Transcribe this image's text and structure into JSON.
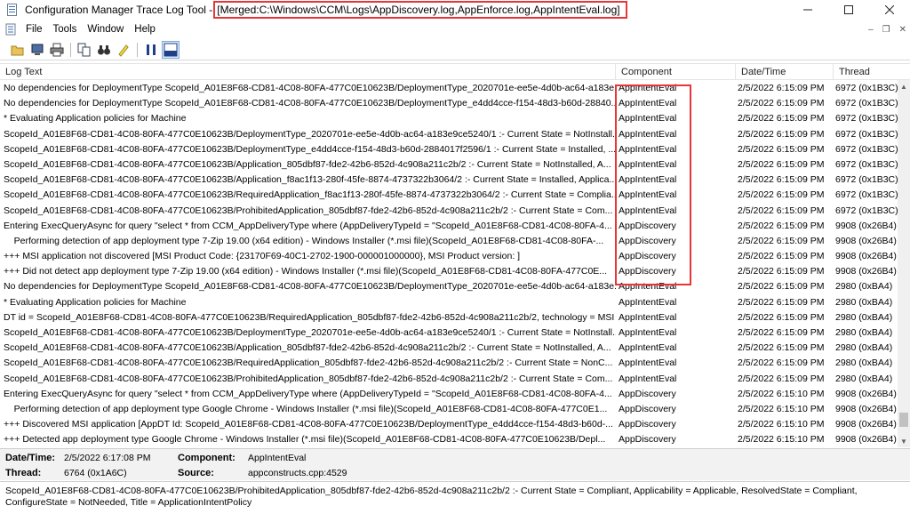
{
  "window": {
    "app_title": "Configuration Manager Trace Log Tool -",
    "merged_title": "[Merged:C:\\Windows\\CCM\\Logs\\AppDiscovery.log,AppEnforce.log,AppIntentEval.log]"
  },
  "menu": [
    "File",
    "Tools",
    "Window",
    "Help"
  ],
  "columns": {
    "log_text": "Log Text",
    "component": "Component",
    "datetime": "Date/Time",
    "thread": "Thread"
  },
  "rows": [
    {
      "text": "No dependencies for DeploymentType ScopeId_A01E8F68-CD81-4C08-80FA-477C0E10623B/DeploymentType_2020701e-ee5e-4d0b-ac64-a183e...",
      "component": "AppIntentEval",
      "datetime": "2/5/2022 6:15:09 PM",
      "thread": "6972 (0x1B3C)"
    },
    {
      "text": "No dependencies for DeploymentType ScopeId_A01E8F68-CD81-4C08-80FA-477C0E10623B/DeploymentType_e4dd4cce-f154-48d3-b60d-28840...",
      "component": "AppIntentEval",
      "datetime": "2/5/2022 6:15:09 PM",
      "thread": "6972 (0x1B3C)"
    },
    {
      "text": "* Evaluating Application policies for Machine",
      "component": "AppIntentEval",
      "datetime": "2/5/2022 6:15:09 PM",
      "thread": "6972 (0x1B3C)"
    },
    {
      "text": "ScopeId_A01E8F68-CD81-4C08-80FA-477C0E10623B/DeploymentType_2020701e-ee5e-4d0b-ac64-a183e9ce5240/1 :- Current State = NotInstall...",
      "component": "AppIntentEval",
      "datetime": "2/5/2022 6:15:09 PM",
      "thread": "6972 (0x1B3C)"
    },
    {
      "text": "ScopeId_A01E8F68-CD81-4C08-80FA-477C0E10623B/DeploymentType_e4dd4cce-f154-48d3-b60d-2884017f2596/1 :- Current State = Installed, ...",
      "component": "AppIntentEval",
      "datetime": "2/5/2022 6:15:09 PM",
      "thread": "6972 (0x1B3C)"
    },
    {
      "text": "ScopeId_A01E8F68-CD81-4C08-80FA-477C0E10623B/Application_805dbf87-fde2-42b6-852d-4c908a211c2b/2 :- Current State = NotInstalled, A...",
      "component": "AppIntentEval",
      "datetime": "2/5/2022 6:15:09 PM",
      "thread": "6972 (0x1B3C)"
    },
    {
      "text": "ScopeId_A01E8F68-CD81-4C08-80FA-477C0E10623B/Application_f8ac1f13-280f-45fe-8874-4737322b3064/2 :- Current State = Installed, Applica...",
      "component": "AppIntentEval",
      "datetime": "2/5/2022 6:15:09 PM",
      "thread": "6972 (0x1B3C)"
    },
    {
      "text": "ScopeId_A01E8F68-CD81-4C08-80FA-477C0E10623B/RequiredApplication_f8ac1f13-280f-45fe-8874-4737322b3064/2 :- Current State = Complia...",
      "component": "AppIntentEval",
      "datetime": "2/5/2022 6:15:09 PM",
      "thread": "6972 (0x1B3C)"
    },
    {
      "text": "ScopeId_A01E8F68-CD81-4C08-80FA-477C0E10623B/ProhibitedApplication_805dbf87-fde2-42b6-852d-4c908a211c2b/2 :- Current State = Com...",
      "component": "AppIntentEval",
      "datetime": "2/5/2022 6:15:09 PM",
      "thread": "6972 (0x1B3C)"
    },
    {
      "text": "Entering ExecQueryAsync for query \"select * from CCM_AppDeliveryType where (AppDeliveryTypeId = \"ScopeId_A01E8F68-CD81-4C08-80FA-4...",
      "component": "AppDiscovery",
      "datetime": "2/5/2022 6:15:09 PM",
      "thread": "9908 (0x26B4)"
    },
    {
      "text": "    Performing detection of app deployment type 7-Zip 19.00 (x64 edition) - Windows Installer (*.msi file)(ScopeId_A01E8F68-CD81-4C08-80FA-...",
      "component": "AppDiscovery",
      "datetime": "2/5/2022 6:15:09 PM",
      "thread": "9908 (0x26B4)"
    },
    {
      "text": "+++ MSI application not discovered [MSI Product Code: {23170F69-40C1-2702-1900-000001000000}, MSI Product version: ]",
      "component": "AppDiscovery",
      "datetime": "2/5/2022 6:15:09 PM",
      "thread": "9908 (0x26B4)"
    },
    {
      "text": "+++ Did not detect app deployment type 7-Zip 19.00 (x64 edition) - Windows Installer (*.msi file)(ScopeId_A01E8F68-CD81-4C08-80FA-477C0E...",
      "component": "AppDiscovery",
      "datetime": "2/5/2022 6:15:09 PM",
      "thread": "9908 (0x26B4)"
    },
    {
      "text": "No dependencies for DeploymentType ScopeId_A01E8F68-CD81-4C08-80FA-477C0E10623B/DeploymentType_2020701e-ee5e-4d0b-ac64-a183e...",
      "component": "AppIntentEval",
      "datetime": "2/5/2022 6:15:09 PM",
      "thread": "2980 (0xBA4)"
    },
    {
      "text": "* Evaluating Application policies for Machine",
      "component": "AppIntentEval",
      "datetime": "2/5/2022 6:15:09 PM",
      "thread": "2980 (0xBA4)"
    },
    {
      "text": "DT id = ScopeId_A01E8F68-CD81-4C08-80FA-477C0E10623B/RequiredApplication_805dbf87-fde2-42b6-852d-4c908a211c2b/2, technology = MSI",
      "component": "AppIntentEval",
      "datetime": "2/5/2022 6:15:09 PM",
      "thread": "2980 (0xBA4)"
    },
    {
      "text": "ScopeId_A01E8F68-CD81-4C08-80FA-477C0E10623B/DeploymentType_2020701e-ee5e-4d0b-ac64-a183e9ce5240/1 :- Current State = NotInstall...",
      "component": "AppIntentEval",
      "datetime": "2/5/2022 6:15:09 PM",
      "thread": "2980 (0xBA4)"
    },
    {
      "text": "ScopeId_A01E8F68-CD81-4C08-80FA-477C0E10623B/Application_805dbf87-fde2-42b6-852d-4c908a211c2b/2 :- Current State = NotInstalled, A...",
      "component": "AppIntentEval",
      "datetime": "2/5/2022 6:15:09 PM",
      "thread": "2980 (0xBA4)"
    },
    {
      "text": "ScopeId_A01E8F68-CD81-4C08-80FA-477C0E10623B/RequiredApplication_805dbf87-fde2-42b6-852d-4c908a211c2b/2 :- Current State = NonC...",
      "component": "AppIntentEval",
      "datetime": "2/5/2022 6:15:09 PM",
      "thread": "2980 (0xBA4)"
    },
    {
      "text": "ScopeId_A01E8F68-CD81-4C08-80FA-477C0E10623B/ProhibitedApplication_805dbf87-fde2-42b6-852d-4c908a211c2b/2 :- Current State = Com...",
      "component": "AppIntentEval",
      "datetime": "2/5/2022 6:15:09 PM",
      "thread": "2980 (0xBA4)"
    },
    {
      "text": "Entering ExecQueryAsync for query \"select * from CCM_AppDeliveryType where (AppDeliveryTypeId = \"ScopeId_A01E8F68-CD81-4C08-80FA-4...",
      "component": "AppDiscovery",
      "datetime": "2/5/2022 6:15:10 PM",
      "thread": "9908 (0x26B4)"
    },
    {
      "text": "    Performing detection of app deployment type Google Chrome - Windows Installer (*.msi file)(ScopeId_A01E8F68-CD81-4C08-80FA-477C0E1...",
      "component": "AppDiscovery",
      "datetime": "2/5/2022 6:15:10 PM",
      "thread": "9908 (0x26B4)"
    },
    {
      "text": "+++ Discovered MSI application [AppDT Id: ScopeId_A01E8F68-CD81-4C08-80FA-477C0E10623B/DeploymentType_e4dd4cce-f154-48d3-b60d-...",
      "component": "AppDiscovery",
      "datetime": "2/5/2022 6:15:10 PM",
      "thread": "9908 (0x26B4)"
    },
    {
      "text": "+++ Detected app deployment type Google Chrome - Windows Installer (*.msi file)(ScopeId_A01E8F68-CD81-4C08-80FA-477C0E10623B/Depl...",
      "component": "AppDiscovery",
      "datetime": "2/5/2022 6:15:10 PM",
      "thread": "9908 (0x26B4)"
    }
  ],
  "details": {
    "datetime_label": "Date/Time:",
    "datetime_value": "2/5/2022 6:17:08 PM",
    "component_label": "Component:",
    "component_value": "AppIntentEval",
    "thread_label": "Thread:",
    "thread_value": "6764 (0x1A6C)",
    "source_label": "Source:",
    "source_value": "appconstructs.cpp:4529"
  },
  "message": "ScopeId_A01E8F68-CD81-4C08-80FA-477C0E10623B/ProhibitedApplication_805dbf87-fde2-42b6-852d-4c908a211c2b/2 :- Current State = Compliant, Applicability = Applicable, ResolvedState = Compliant, ConfigureState = NotNeeded, Title = ApplicationIntentPolicy",
  "colors": {
    "annotation_red": "#e8353a"
  }
}
